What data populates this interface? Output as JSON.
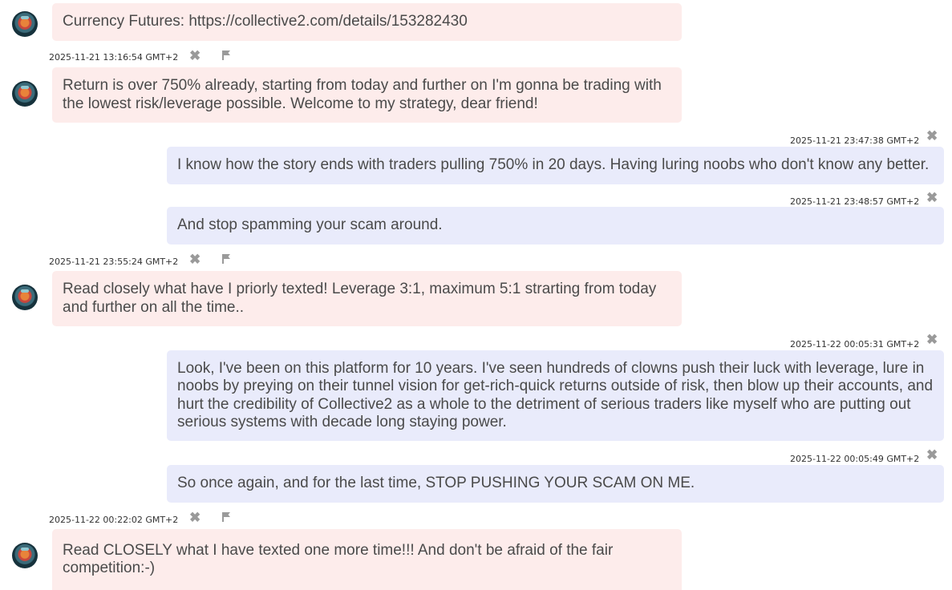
{
  "icons": {
    "delete": "close-icon",
    "report": "flag-icon",
    "avatar": "avatar"
  },
  "colors": {
    "incoming_bg": "#fdeceb",
    "outgoing_bg": "#e9ebfb",
    "text": "#4a4a4a",
    "icon": "#9a9a9a"
  },
  "messages": [
    {
      "direction": "incoming",
      "text": "Currency Futures: https://collective2.com/details/153282430",
      "timestamp": "2025-11-21 13:16:54 GMT+2"
    },
    {
      "direction": "incoming",
      "text": "Return is over 750% already, starting from today and further on I'm gonna be trading with the lowest risk/leverage possible. Welcome to my strategy, dear friend!",
      "timestamp": ""
    },
    {
      "direction": "outgoing",
      "timestamp": "2025-11-21 23:47:38 GMT+2",
      "text": "I know how the story ends with traders pulling 750% in 20 days. Having luring noobs who don't know any better."
    },
    {
      "direction": "outgoing",
      "timestamp": "2025-11-21 23:48:57 GMT+2",
      "text": "And stop spamming your scam around."
    },
    {
      "direction": "incoming",
      "timestamp": "2025-11-21 23:55:24 GMT+2",
      "text": "Read closely what have I priorly texted! Leverage 3:1, maximum 5:1 strarting from today and further on all the time.."
    },
    {
      "direction": "outgoing",
      "timestamp": "2025-11-22 00:05:31 GMT+2",
      "text": "Look, I've been on this platform for 10 years. I've seen hundreds of clowns push their luck with leverage, lure in noobs by preying on their tunnel vision for get-rich-quick returns outside of risk, then blow up their accounts, and hurt the credibility of Collective2 as a whole to the detriment of serious traders like myself who are putting out serious systems with decade long staying power."
    },
    {
      "direction": "outgoing",
      "timestamp": "2025-11-22 00:05:49 GMT+2",
      "text": "So once again, and for the last time, STOP PUSHING YOUR SCAM ON ME."
    },
    {
      "direction": "incoming",
      "timestamp": "2025-11-22 00:22:02 GMT+2",
      "text": "Read CLOSELY what I have texted one more time!!! And don't be afraid of the fair competition:-)"
    }
  ]
}
